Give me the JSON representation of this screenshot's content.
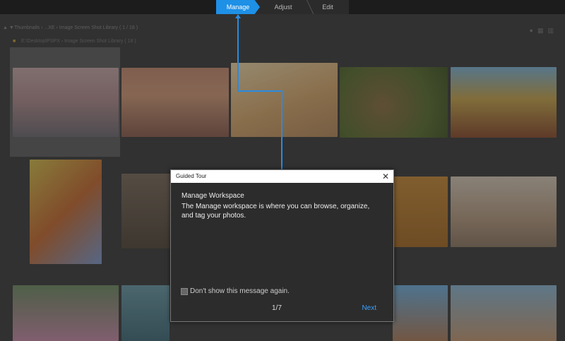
{
  "tabs": [
    {
      "label": "Manage",
      "active": true
    },
    {
      "label": "Adjust",
      "active": false
    },
    {
      "label": "Edit",
      "active": false
    }
  ],
  "browser": {
    "breadcrumb": "Thumbnails  ›  ...XE  ›  Image Screen Shot Library  ( 1 / 18 )",
    "folder_path": "E:\\Desktop\\PSPX  ›  Image Screen Shot Library  ( 18 )"
  },
  "dialog": {
    "title": "Guided Tour",
    "heading": "Manage Workspace",
    "body": "The Manage workspace is where you can browse, organize, and tag your photos.",
    "checkbox_label": "Don't show this message again.",
    "pager": "1/7",
    "next_label": "Next"
  },
  "colors": {
    "accent": "#1e90e6",
    "link": "#3aa0ff"
  }
}
